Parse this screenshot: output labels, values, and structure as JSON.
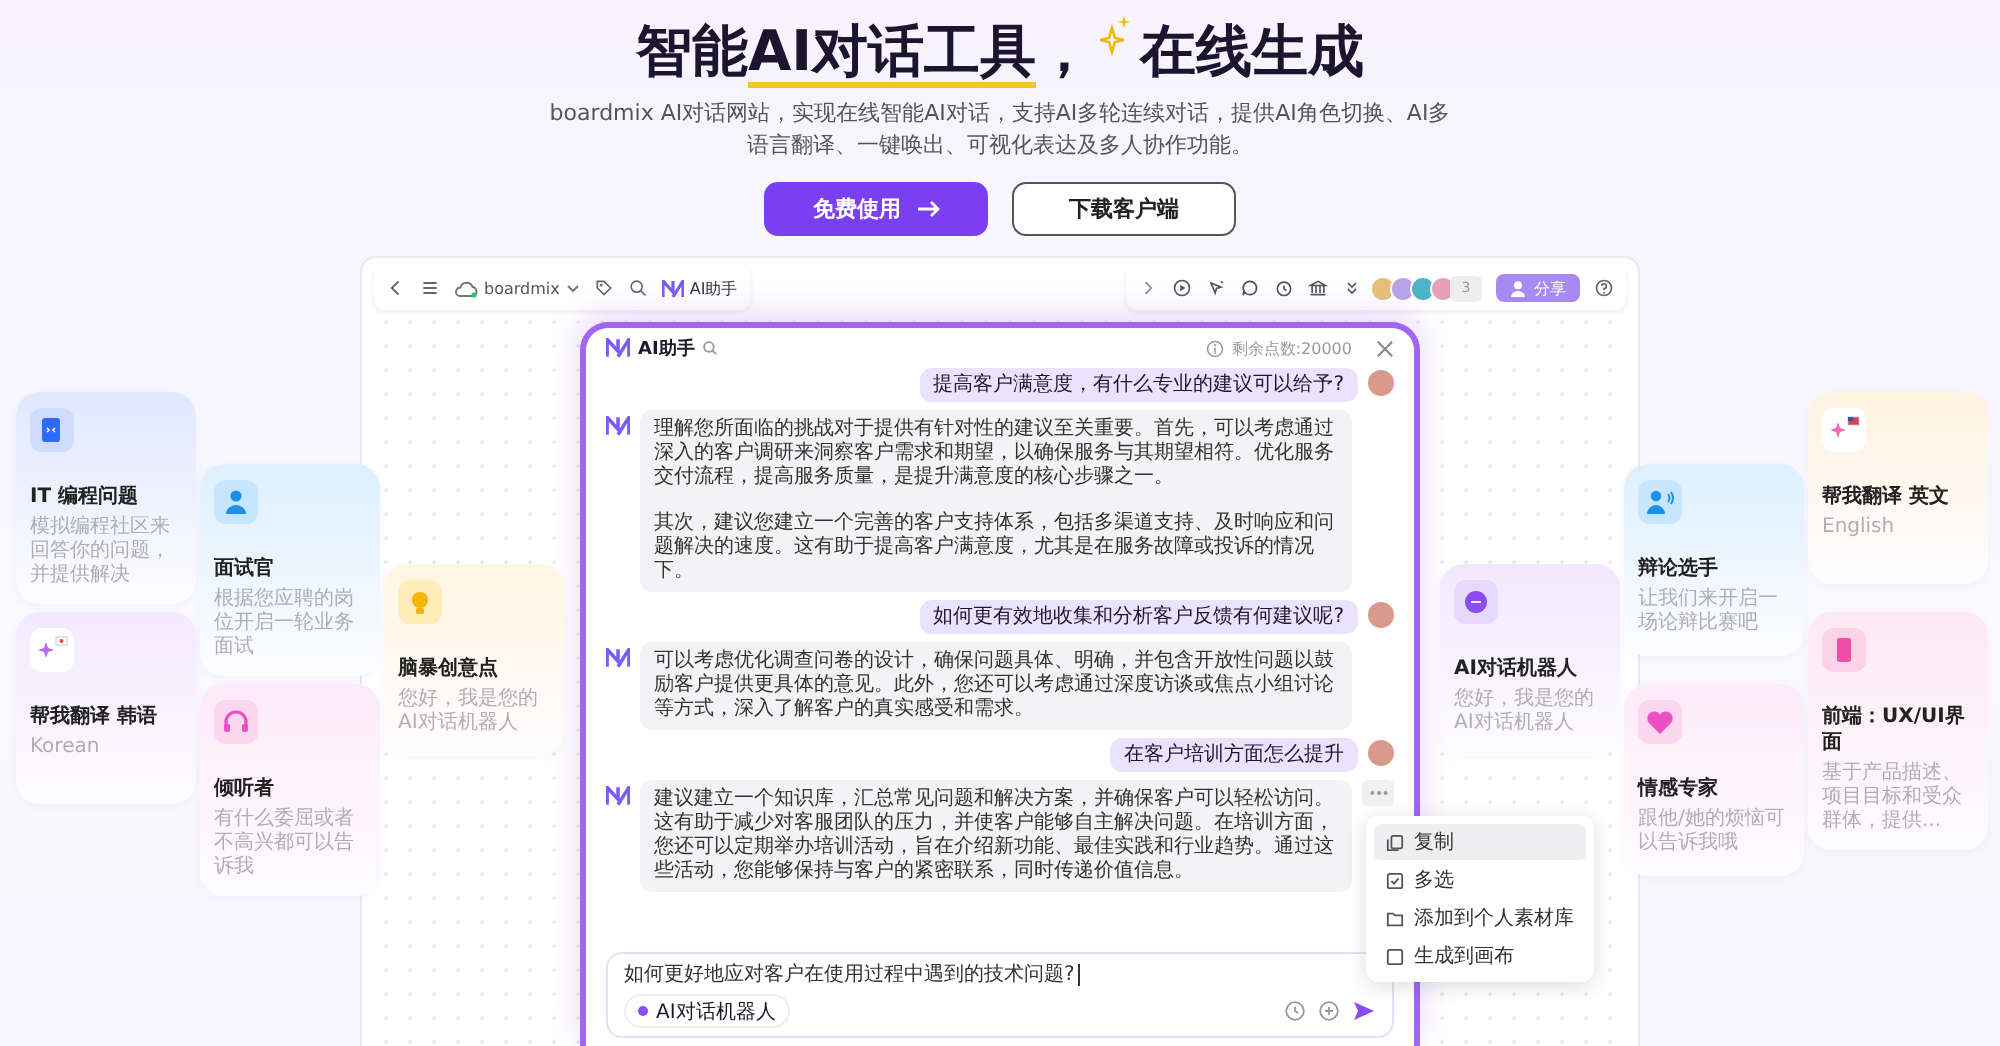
{
  "hero": {
    "title": {
      "prefix": "智能",
      "marked": "AI对话工具",
      "suffix": "，"
    },
    "title_tail": "在线生成",
    "subtitle": "boardmix AI对话网站，实现在线智能AI对话，支持AI多轮连续对话，提供AI角色切换、AI多语言翻译、一键唤出、可视化表达及多人协作功能。",
    "buttons": [
      {
        "label": "免费使用",
        "kind": "primary"
      },
      {
        "label": "下载客户端",
        "kind": "secondary"
      }
    ]
  },
  "toolbar": {
    "brand": "boardmix",
    "assistant": "AI助手",
    "avatar_more": "3",
    "share": "分享"
  },
  "chat": {
    "title": "AI助手",
    "points": "剩余点数:20000",
    "messages": [
      {
        "kind": "user",
        "paragraphs": [
          "提高客户满意度，有什么专业的建议可以给予?"
        ]
      },
      {
        "kind": "ai",
        "paragraphs": [
          "理解您所面临的挑战对于提供有针对性的建议至关重要。首先，可以考虑通过深入的客户调研来洞察客户需求和期望，以确保服务与其期望相符。优化服务交付流程，提高服务质量，是提升满意度的核心步骤之一。",
          "其次，建议您建立一个完善的客户支持体系，包括多渠道支持、及时响应和问题解决的速度。这有助于提高客户满意度，尤其是在服务故障或投诉的情况下。"
        ]
      },
      {
        "kind": "user",
        "paragraphs": [
          "如何更有效地收集和分析客户反馈有何建议呢?"
        ]
      },
      {
        "kind": "ai",
        "paragraphs": [
          "可以考虑优化调查问卷的设计，确保问题具体、明确，并包含开放性问题以鼓励客户提供更具体的意见。此外，您还可以考虑通过深度访谈或焦点小组讨论等方式，深入了解客户的真实感受和需求。"
        ]
      },
      {
        "kind": "user",
        "paragraphs": [
          "在客户培训方面怎么提升"
        ]
      },
      {
        "kind": "ai",
        "paragraphs": [
          "建议建立一个知识库，汇总常见问题和解决方案，并确保客户可以轻松访问。这有助于减少对客服团队的压力，并使客户能够自主解决问题。在培训方面，您还可以定期举办培训活动，旨在介绍新功能、最佳实践和行业趋势。通过这些活动，您能够保持与客户的紧密联系，同时传递价值信息。"
        ],
        "menu": [
          {
            "label": "复制",
            "kind": "copy",
            "selected": true
          },
          {
            "label": "多选",
            "kind": "select",
            "selected": false
          },
          {
            "label": "添加到个人素材库",
            "kind": "save",
            "selected": false
          },
          {
            "label": "生成到画布",
            "kind": "canvas",
            "selected": false
          }
        ]
      }
    ],
    "input": {
      "value": "如何更好地应对客户在使用过程中遇到的技术问题?",
      "chip": "AI对话机器人"
    }
  },
  "cards": [
    {
      "kind": "coding",
      "title": "IT 编程问题",
      "subtitle": "模拟编程社区来回答你的问题，并提供解决"
    },
    {
      "kind": "korean",
      "title": "帮我翻译 韩语",
      "subtitle": "Korean"
    },
    {
      "kind": "interview",
      "title": "面试官",
      "subtitle": "根据您应聘的岗位开启一轮业务面试"
    },
    {
      "kind": "listener",
      "title": "倾听者",
      "subtitle": "有什么委屈或者不高兴都可以告诉我"
    },
    {
      "kind": "brainstorm",
      "title": "脑暴创意点",
      "subtitle": "您好，我是您的AI对话机器人"
    },
    {
      "kind": "chatbot",
      "title": "AI对话机器人",
      "subtitle": "您好，我是您的AI对话机器人"
    },
    {
      "kind": "debate",
      "title": "辩论选手",
      "subtitle": "让我们来开启一场论辩比赛吧"
    },
    {
      "kind": "emotion",
      "title": "情感专家",
      "subtitle": "跟他/她的烦恼可以告诉我哦"
    },
    {
      "kind": "english",
      "title": "帮我翻译 英文",
      "subtitle": "English"
    },
    {
      "kind": "frontend",
      "title": "前端：UX/UI界面",
      "subtitle": "基于产品描述、项目目标和受众群体，提供..."
    }
  ]
}
